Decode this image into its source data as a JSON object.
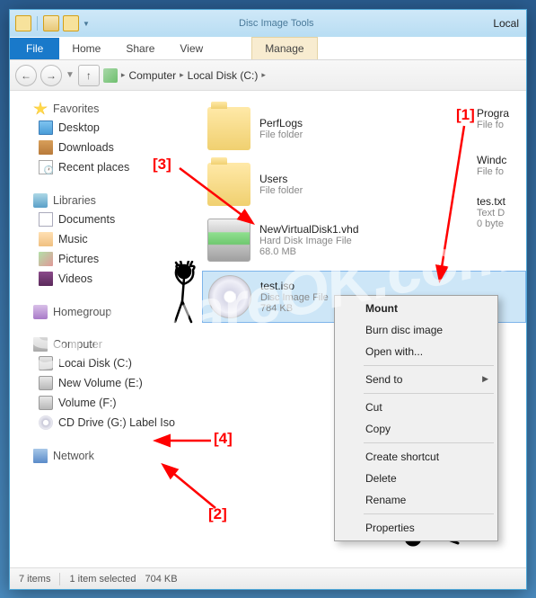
{
  "watermark": "SoftwareOK.com",
  "titlebar": {
    "context_tab_title": "Disc Image Tools",
    "window_title_partial": "Local"
  },
  "ribbon": {
    "file": "File",
    "home": "Home",
    "share": "Share",
    "view": "View",
    "manage": "Manage"
  },
  "breadcrumb": {
    "seg1": "Computer",
    "seg2": "Local Disk (C:)"
  },
  "sidebar": {
    "favorites": {
      "label": "Favorites",
      "items": [
        "Desktop",
        "Downloads",
        "Recent places"
      ]
    },
    "libraries": {
      "label": "Libraries",
      "items": [
        "Documents",
        "Music",
        "Pictures",
        "Videos"
      ]
    },
    "homegroup": {
      "label": "Homegroup"
    },
    "computer": {
      "label": "Computer",
      "items": [
        "Local Disk (C:)",
        "New Volume (E:)",
        "Volume (F:)",
        "CD Drive (G:) Label Iso"
      ]
    },
    "network": {
      "label": "Network"
    }
  },
  "files": {
    "perflogs": {
      "name": "PerfLogs",
      "type": "File folder"
    },
    "users": {
      "name": "Users",
      "type": "File folder"
    },
    "vhd": {
      "name": "NewVirtualDisk1.vhd",
      "type": "Hard Disk Image File",
      "size": "68.0 MB"
    },
    "iso": {
      "name": "test.iso",
      "type": "Disc Image File",
      "size": "784 KB"
    },
    "progra": {
      "name": "Progra",
      "type": "File fo"
    },
    "windo": {
      "name": "Windc",
      "type": "File fo"
    },
    "testxt": {
      "name": "tes.txt",
      "type": "Text D",
      "size": "0 byte"
    }
  },
  "context_menu": {
    "mount": "Mount",
    "burn": "Burn disc image",
    "openwith": "Open with...",
    "sendto": "Send to",
    "cut": "Cut",
    "copy": "Copy",
    "shortcut": "Create shortcut",
    "delete": "Delete",
    "rename": "Rename",
    "properties": "Properties"
  },
  "statusbar": {
    "count": "7 items",
    "selection": "1 item selected",
    "size": "704 KB"
  },
  "annotations": {
    "a1": "[1]",
    "a2": "[2]",
    "a3": "[3]",
    "a4": "[4]"
  }
}
